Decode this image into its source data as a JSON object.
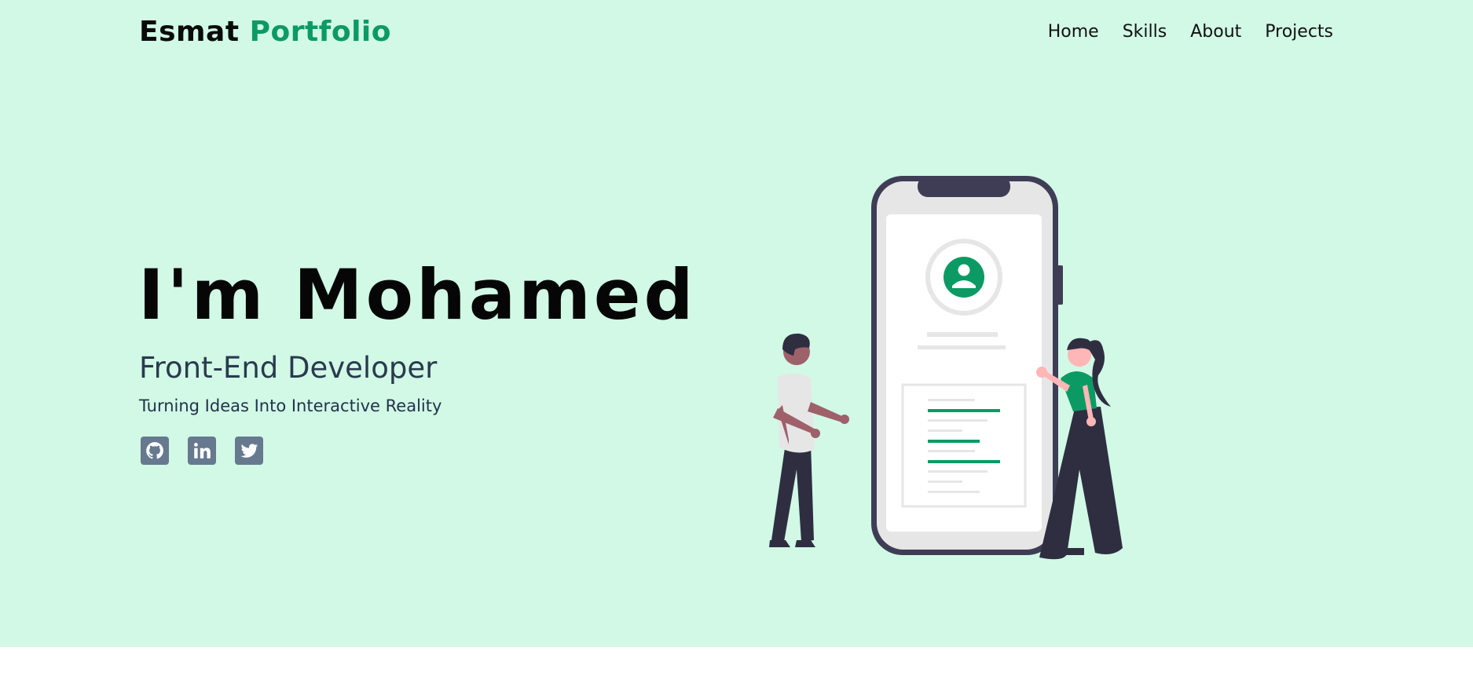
{
  "brand": {
    "name_primary": "Esmat",
    "name_accent": "Portfolio",
    "accent_color": "#0c9a64"
  },
  "nav": {
    "items": [
      "Home",
      "Skills",
      "About",
      "Projects"
    ]
  },
  "hero": {
    "title": "I'm Mohamed",
    "role": "Front-End Developer",
    "tagline": "Turning Ideas Into Interactive Reality",
    "background_color": "#d1f9e6"
  },
  "social": {
    "icons": [
      "github-icon",
      "linkedin-icon",
      "twitter-icon"
    ],
    "icon_color": "#66798f"
  }
}
